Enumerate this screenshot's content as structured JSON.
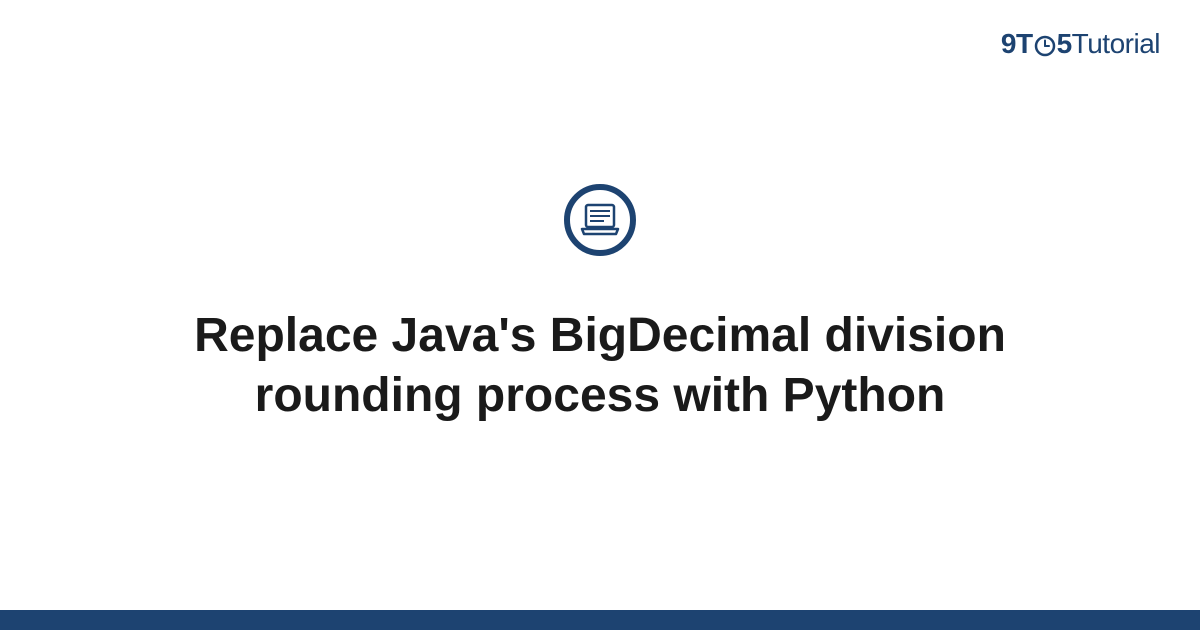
{
  "logo": {
    "prefix_nine": "9",
    "prefix_t": "T",
    "prefix_five": "5",
    "suffix": "Tutorial"
  },
  "article": {
    "title": "Replace Java's BigDecimal division rounding process with Python"
  },
  "colors": {
    "brand": "#1d4371",
    "text": "#1a1a1a"
  }
}
